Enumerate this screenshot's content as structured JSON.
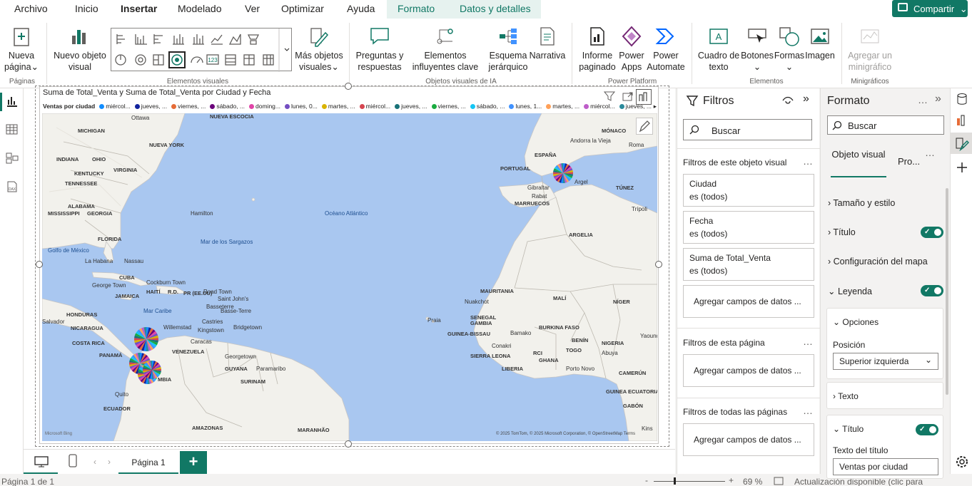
{
  "menubar": {
    "items": [
      "Archivo",
      "Inicio",
      "Insertar",
      "Modelado",
      "Ver",
      "Optimizar",
      "Ayuda",
      "Formato",
      "Datos y detalles"
    ],
    "share_label": "Compartir"
  },
  "ribbon": {
    "new_page": "Nueva página",
    "new_visual": "Nuevo objeto visual",
    "more_visuals": "Más objetos visuales",
    "qa": "Preguntas y respuestas",
    "key_influencers": "Elementos influyentes clave",
    "decomp_tree": "Esquema jerárquico",
    "narrative": "Narrativa",
    "paginated": "Informe paginado",
    "power_apps": "Power Apps",
    "power_automate": "Power Automate",
    "textbox": "Cuadro de texto",
    "buttons": "Botones",
    "shapes": "Formas",
    "image": "Imagen",
    "sparkline": "Agregar un minigráfico",
    "groups": {
      "pages": "Páginas",
      "visuals": "Elementos visuales",
      "ai": "Objetos visuales de IA",
      "power_platform": "Power Platform",
      "elements": "Elementos",
      "sparklines": "Minigráficos"
    }
  },
  "visual": {
    "title": "Suma de Total_Venta y Suma de Total_Venta por Ciudad y Fecha",
    "legend_title": "Ventas por ciudad",
    "legend_items": [
      {
        "label": "miércol...",
        "color": "#118dff"
      },
      {
        "label": "jueves, ...",
        "color": "#12239e"
      },
      {
        "label": "viernes, ...",
        "color": "#e66c37"
      },
      {
        "label": "sábado, ...",
        "color": "#6b007b"
      },
      {
        "label": "doming...",
        "color": "#e044a7"
      },
      {
        "label": "lunes, 0...",
        "color": "#744ec2"
      },
      {
        "label": "martes, ...",
        "color": "#d9b300"
      },
      {
        "label": "miércol...",
        "color": "#d64550"
      },
      {
        "label": "jueves, ...",
        "color": "#197278"
      },
      {
        "label": "viernes, ...",
        "color": "#1aab40"
      },
      {
        "label": "sábado, ...",
        "color": "#15c6f4"
      },
      {
        "label": "lunes, 1...",
        "color": "#4092ff"
      },
      {
        "label": "martes, ...",
        "color": "#ffa058"
      },
      {
        "label": "miércol...",
        "color": "#be5dc9"
      },
      {
        "label": "jueves, ...",
        "color": "#2b8a9b"
      }
    ],
    "bing": "Microsoft Bing",
    "copyright": "© 2025 TomTom, © 2025 Microsoft Corporation, © OpenStreetMap  Terms"
  },
  "map_labels": [
    "MICHIGAN",
    "Ottawa",
    "NUEVA ESCOCIA",
    "NUEVA YORK",
    "INDIANA",
    "OHIO",
    "KENTUCKY",
    "VIRGINIA",
    "TENNESSEE",
    "ALABAMA",
    "MISSISSIPPI",
    "GEORGIA",
    "FLORIDA",
    "Golfo de México",
    "La Habana",
    "Nassau",
    "CUBA",
    "Cockburn Town",
    "George Town",
    "JAMAICA",
    "HAITÍ",
    "R.D.",
    "PR (EE.UU)",
    "Road Town",
    "Saint John's",
    "Basseterre",
    "Mar Caribe",
    "Basse-Terre",
    "Castries",
    "Kingstown",
    "Bridgetown",
    "Willemstad",
    "HONDURAS",
    "NICARAGUA",
    "COSTA RICA",
    "PANAMÁ",
    "Caracas",
    "VENEZUELA",
    "Georgetown",
    "GUYANA",
    "SURINAM",
    "Paramaribo",
    "Quito",
    "ECUADOR",
    "MBIA",
    "AMAZONAS",
    "MARANHÃO",
    "Hamilton",
    "Océano Atlántico",
    "Mar de los Sargazos",
    "Praia",
    "Nuakchot",
    "MAURITANIA",
    "SENEGAL",
    "GAMBIA",
    "GUINEA-BISSAU",
    "Bamako",
    "Conakri",
    "SIERRA LEONA",
    "LIBERIA",
    "RCI",
    "MALÍ",
    "BURKINA FASO",
    "GHANA",
    "TOGO",
    "BENÍN",
    "Porto Novo",
    "Abuya",
    "NIGERIA",
    "NÍGER",
    "CAMERÚN",
    "GUINEA ECUATORIAL",
    "GABÓN",
    "Kins",
    "Yaoundé",
    "Gibraltar",
    "Rabat",
    "MARRUECOS",
    "Argel",
    "ARGELIA",
    "TÚNEZ",
    "Trípoli",
    "ESPAÑA",
    "PORTUGAL",
    "Andorra la Vieja",
    "MÓNACO",
    "Roma",
    "Salvador"
  ],
  "pagebar": {
    "page_tab": "Página 1",
    "add": "+"
  },
  "statusbar": {
    "page": "Página 1 de 1",
    "zoom": "69 %",
    "update": "Actualización disponible (clic para descargarla)"
  },
  "filters": {
    "title": "Filtros",
    "search_placeholder": "Buscar",
    "visual_section": "Filtros de este objeto visual",
    "cards": [
      {
        "name": "Ciudad",
        "state": "es (todos)"
      },
      {
        "name": "Fecha",
        "state": "es (todos)"
      },
      {
        "name": "Suma de Total_Venta",
        "state": "es (todos)"
      }
    ],
    "add_fields": "Agregar campos de datos ...",
    "page_section": "Filtros de esta página",
    "all_pages_section": "Filtros de todas las páginas"
  },
  "format": {
    "title": "Formato",
    "search_placeholder": "Buscar",
    "tab_visual": "Objeto visual",
    "tab_general": "Pro...",
    "sections": [
      "Tamaño y estilo",
      "Título",
      "Configuración del mapa",
      "Leyenda"
    ],
    "options": "Opciones",
    "position_label": "Posición",
    "position_value": "Superior izquierda",
    "text": "Texto",
    "title_section": "Título",
    "title_text_label": "Texto del título",
    "title_text_value": "Ventas por ciudad"
  }
}
